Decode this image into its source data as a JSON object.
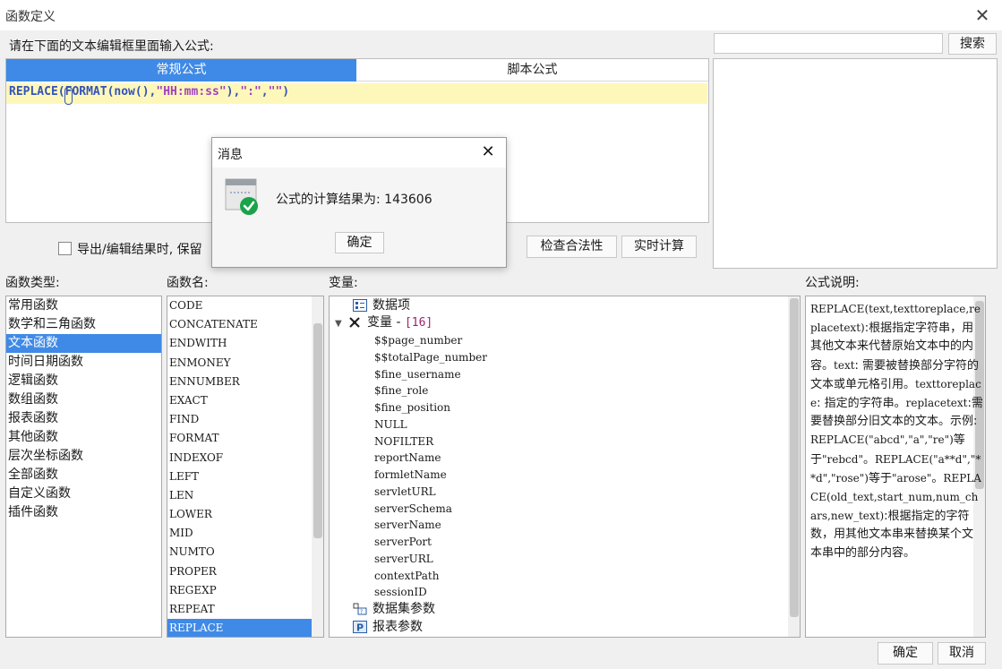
{
  "window": {
    "title": "函数定义"
  },
  "prompt": "请在下面的文本编辑框里面输入公式:",
  "search": {
    "button": "搜索",
    "placeholder": ""
  },
  "tabs": {
    "regular": "常规公式",
    "script": "脚本公式"
  },
  "formula": {
    "parts": [
      "REPLACE(FORMAT(now(),",
      "\"HH:mm:ss\"",
      "),",
      "\":\"",
      ",",
      "\"\"",
      ")"
    ]
  },
  "options": {
    "keep_formula_label": "导出/编辑结果时, 保留",
    "check_button": "检查合法性",
    "calc_button": "实时计算"
  },
  "sections": {
    "types": "函数类型:",
    "names": "函数名:",
    "vars": "变量:",
    "desc": "公式说明:"
  },
  "function_types": [
    "常用函数",
    "数学和三角函数",
    "文本函数",
    "时间日期函数",
    "逻辑函数",
    "数组函数",
    "报表函数",
    "其他函数",
    "层次坐标函数",
    "全部函数",
    "自定义函数",
    "插件函数"
  ],
  "selected_type": "文本函数",
  "function_names": [
    "CODE",
    "CONCATENATE",
    "ENDWITH",
    "ENMONEY",
    "ENNUMBER",
    "EXACT",
    "FIND",
    "FORMAT",
    "INDEXOF",
    "LEFT",
    "LEN",
    "LOWER",
    "MID",
    "NUMTO",
    "PROPER",
    "REGEXP",
    "REPEAT",
    "REPLACE"
  ],
  "selected_function": "REPLACE",
  "variables": {
    "data_items": "数据项",
    "vars_group": "变量 - ",
    "vars_count": "[16]",
    "leaves": [
      "$$page_number",
      "$$totalPage_number",
      "$fine_username",
      "$fine_role",
      "$fine_position",
      "NULL",
      "NOFILTER",
      "reportName",
      "formletName",
      "servletURL",
      "serverSchema",
      "serverName",
      "serverPort",
      "serverURL",
      "contextPath",
      "sessionID"
    ],
    "dataset_params": "数据集参数",
    "report_params": "报表参数"
  },
  "description": [
    {
      "t": "REPLACE(text,texttoreplace,replacetext)",
      "mono": true
    },
    {
      "t": ":根据指定字符串，用其他文本来代替原始文本中的内容。",
      "mono": false
    },
    {
      "t": "text",
      "mono": true
    },
    {
      "t": ": 需要被替换部分字符的文本或单元格引用。",
      "mono": false
    },
    {
      "t": "texttoreplace",
      "mono": true
    },
    {
      "t": ": 指定的字符串。",
      "mono": false
    },
    {
      "t": "replacetext",
      "mono": true
    },
    {
      "t": ":需要替换部分旧文本的文本。",
      "mono": false
    },
    {
      "t": "示例:",
      "mono": false
    },
    {
      "t": "REPLACE(\"abcd\",\"a\",\"re\")",
      "mono": true
    },
    {
      "t": "等于",
      "mono": false
    },
    {
      "t": "\"rebcd\"",
      "mono": true
    },
    {
      "t": "。",
      "mono": false
    },
    {
      "t": "REPLACE(\"a**d\",\"**d\",\"rose\")",
      "mono": true
    },
    {
      "t": "等于",
      "mono": false
    },
    {
      "t": "\"arose\"",
      "mono": true
    },
    {
      "t": "。",
      "mono": false
    },
    {
      "t": "REPLACE(old_text,start_num,num_chars,new_text)",
      "mono": true
    },
    {
      "t": ":根据指定的字符数，用其他文本串来替换某个文本串中的部分内容。",
      "mono": false
    }
  ],
  "footer": {
    "ok": "确定",
    "cancel": "取消"
  },
  "dialog": {
    "title": "消息",
    "message": "公式的计算结果为: 143606",
    "ok": "确定"
  },
  "colors": {
    "accent": "#3f8ae6",
    "formula_bg": "#fdf8ba",
    "success": "#1aa34a"
  }
}
